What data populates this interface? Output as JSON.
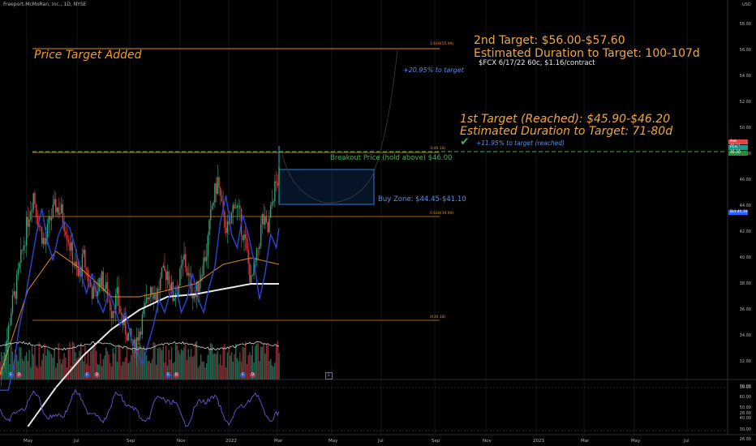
{
  "header": {
    "symbol_line": "Freeport-McMoRan, Inc., 1D, NYSE",
    "currency": "USD"
  },
  "annotations": {
    "price_target_added": "Price Target Added",
    "second_target": "2nd Target: $56.00-$57.60",
    "second_duration": "Estimated Duration to Target: 100-107d",
    "option_note": "$FCX 6/17/22 60c, $1.16/contract",
    "pct_to_target_2": "+20.95% to target",
    "first_target": "1st Target (Reached): $45.90-$46.20",
    "first_duration": "Estimated Duration to Target: 71-80d",
    "check_symbol": "✔",
    "pct_to_target_1": "+11.95% to target (reached)",
    "breakout": "Breakout Price (hold above) $46.00",
    "buy_zone": "Buy Zone: $44.45-$41.10"
  },
  "fib_labels": {
    "f1618": "1.618(55.99)",
    "f1": "1(46.18)",
    "f0618": "0.618(39.99)",
    "f0": "0(30.18)"
  },
  "price_tags": {
    "ask_label": "Ask",
    "ask_value": "46.34",
    "fcx_label": "FCX",
    "fcx_value": "46.34",
    "last_value": "46.00",
    "bid_label": "Bid",
    "bid_value": "40.30"
  },
  "axis": {
    "y_ticks": [
      "58.00",
      "56.00",
      "54.00",
      "52.00",
      "50.00",
      "48.00",
      "46.00",
      "44.00",
      "42.00",
      "40.00",
      "38.00",
      "36.00",
      "34.00",
      "32.00",
      "30.00",
      "28.00",
      "26.00"
    ],
    "osc_ticks": [
      "70.00",
      "60.00",
      "50.00",
      "40.00",
      "30.00"
    ],
    "x_ticks": [
      "May",
      "Jul",
      "Sep",
      "Nov",
      "2022",
      "Mar",
      "May",
      "Jul",
      "Sep",
      "Nov",
      "2023",
      "Mar",
      "May",
      "Jul"
    ]
  },
  "events": {
    "markers_left": [
      "E",
      "D",
      "E",
      "D",
      "E",
      "D",
      "E",
      "D"
    ],
    "marker_right": "E"
  },
  "chart_data": {
    "type": "candlestick",
    "ylim": [
      25,
      59
    ],
    "fib_levels": [
      55.99,
      46.18,
      39.99,
      30.18
    ],
    "breakout_price": 46.0,
    "buy_zone": [
      41.1,
      44.45
    ],
    "price_series_approx": [
      [
        0,
        31
      ],
      [
        4,
        33
      ],
      [
        8,
        36
      ],
      [
        12,
        38
      ],
      [
        16,
        40.5
      ],
      [
        20,
        43
      ],
      [
        24,
        45
      ],
      [
        28,
        42.5
      ],
      [
        32,
        41
      ],
      [
        36,
        43
      ],
      [
        40,
        44
      ],
      [
        44,
        43.5
      ],
      [
        48,
        42
      ],
      [
        52,
        40
      ],
      [
        56,
        38.5
      ],
      [
        60,
        40
      ],
      [
        64,
        38
      ],
      [
        68,
        37
      ],
      [
        72,
        38.5
      ],
      [
        76,
        37.5
      ],
      [
        80,
        36
      ],
      [
        84,
        37
      ],
      [
        88,
        35
      ],
      [
        92,
        34
      ],
      [
        96,
        33
      ],
      [
        100,
        34.5
      ],
      [
        104,
        36
      ],
      [
        108,
        38
      ],
      [
        112,
        37
      ],
      [
        116,
        38.5
      ],
      [
        120,
        39
      ],
      [
        124,
        37
      ],
      [
        128,
        38
      ],
      [
        132,
        40
      ],
      [
        136,
        38
      ],
      [
        140,
        37
      ],
      [
        144,
        39
      ],
      [
        148,
        40.5
      ],
      [
        152,
        44
      ],
      [
        156,
        46
      ],
      [
        160,
        43
      ],
      [
        164,
        42
      ],
      [
        168,
        44.5
      ],
      [
        172,
        43
      ],
      [
        176,
        41
      ],
      [
        180,
        38
      ],
      [
        184,
        40
      ],
      [
        188,
        43
      ],
      [
        192,
        42
      ],
      [
        196,
        45
      ],
      [
        200,
        46.3
      ]
    ],
    "ma_200_approx": [
      [
        20,
        27
      ],
      [
        40,
        30
      ],
      [
        60,
        32.5
      ],
      [
        80,
        34.5
      ],
      [
        100,
        36
      ],
      [
        120,
        37
      ],
      [
        140,
        37.2
      ],
      [
        160,
        37.6
      ],
      [
        180,
        38
      ],
      [
        200,
        38
      ]
    ],
    "ma_50_approx": [
      [
        0,
        31
      ],
      [
        20,
        37.5
      ],
      [
        40,
        40.5
      ],
      [
        60,
        39
      ],
      [
        80,
        37
      ],
      [
        100,
        37
      ],
      [
        120,
        37.5
      ],
      [
        140,
        38
      ],
      [
        160,
        39.5
      ],
      [
        180,
        40
      ],
      [
        200,
        39.5
      ]
    ],
    "projection": "target path toward 55.99"
  }
}
